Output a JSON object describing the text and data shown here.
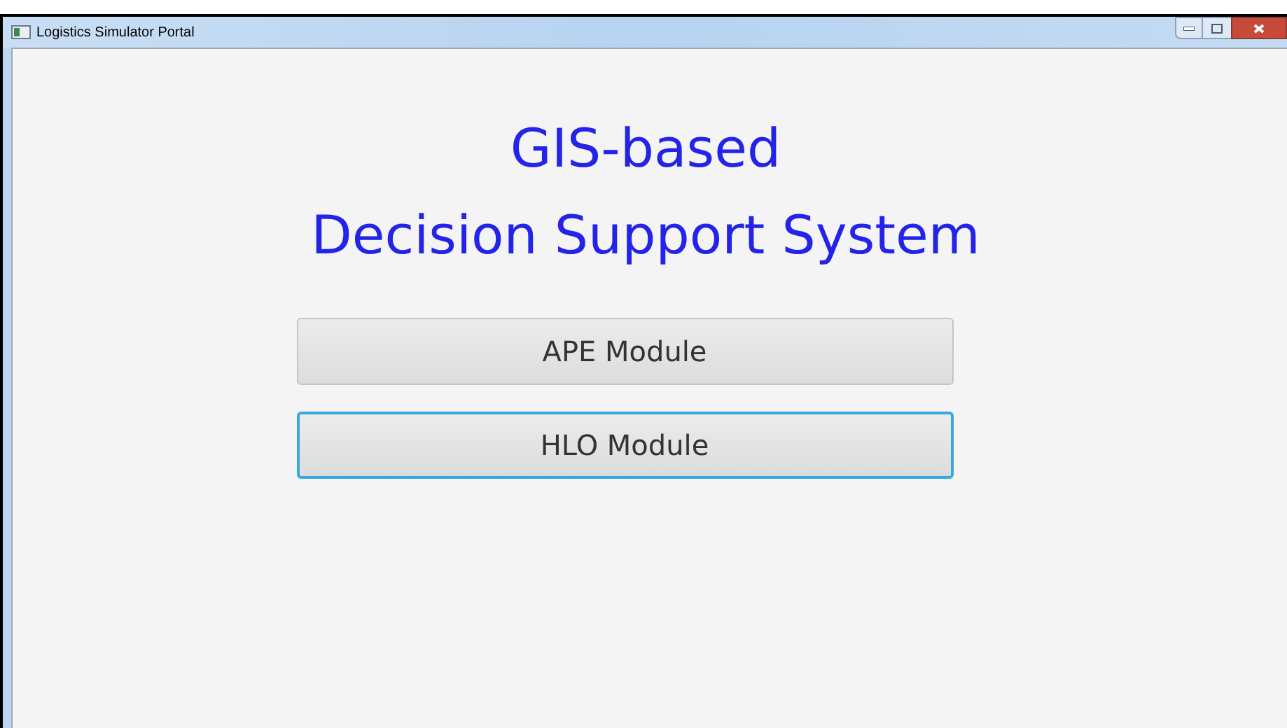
{
  "window": {
    "title": "Logistics Simulator Portal"
  },
  "heading": {
    "lines": [
      "GIS-based",
      "Decision Support System"
    ]
  },
  "buttons": [
    {
      "label": "APE Module",
      "focused": false
    },
    {
      "label": "HLO Module",
      "focused": true
    }
  ]
}
